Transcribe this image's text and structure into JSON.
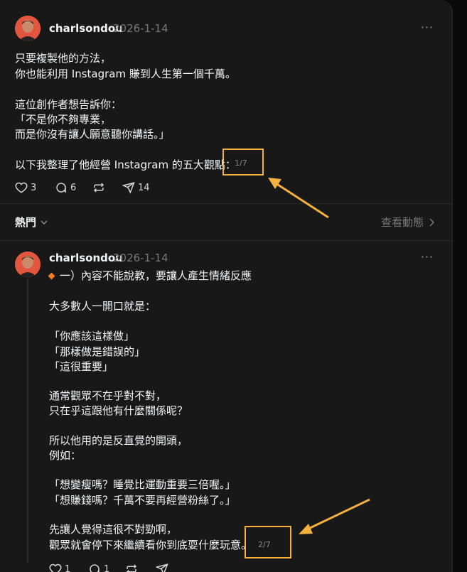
{
  "post1": {
    "username": "charlsondou",
    "timestamp": "2026-1-14",
    "lines": [
      "只要複製他的方法，",
      "你也能利用 Instagram 賺到人生第一個千萬。",
      "這位創作者想告訴你：",
      "「不是你不夠專業，",
      "而是你沒有讓人願意聽你講話。」",
      "以下我整理了他經營 Instagram 的五大觀點："
    ],
    "counter": "1/7",
    "actions": {
      "likes": "3",
      "comments": "6",
      "shares": "14"
    }
  },
  "sort_bar": {
    "label": "熱門",
    "view_activity": "查看動態"
  },
  "post2": {
    "username": "charlsondou",
    "timestamp": "2026-1-14",
    "heading": "一）內容不能說教，要讓人產生情緒反應",
    "lines": [
      "大多數人一開口就是：",
      "「你應該這樣做」",
      "「那樣做是錯誤的」",
      "「這很重要」",
      "通常觀眾不在乎對不對，",
      "只在乎這跟他有什麼關係呢？",
      "所以他用的是反直覺的開頭，",
      "例如：",
      "「想變瘦嗎？睡覺比運動重要三倍喔。」",
      "「想賺錢嗎？千萬不要再經營粉絲了。」",
      "先讓人覺得這很不對勁啊，",
      "觀眾就會停下來繼續看你到底耍什麼玩意。"
    ],
    "counter": "2/7",
    "actions": {
      "likes": "1",
      "comments": "1"
    }
  },
  "colors": {
    "background": "#181818",
    "highlight": "#f5b13d",
    "diamond": "#f47c20",
    "avatar": "#e2563f"
  },
  "icons": [
    "heart-icon",
    "comment-icon",
    "repost-icon",
    "share-icon",
    "more-icon",
    "chevron-down-icon",
    "chevron-right-icon",
    "diamond-bullet-icon"
  ]
}
